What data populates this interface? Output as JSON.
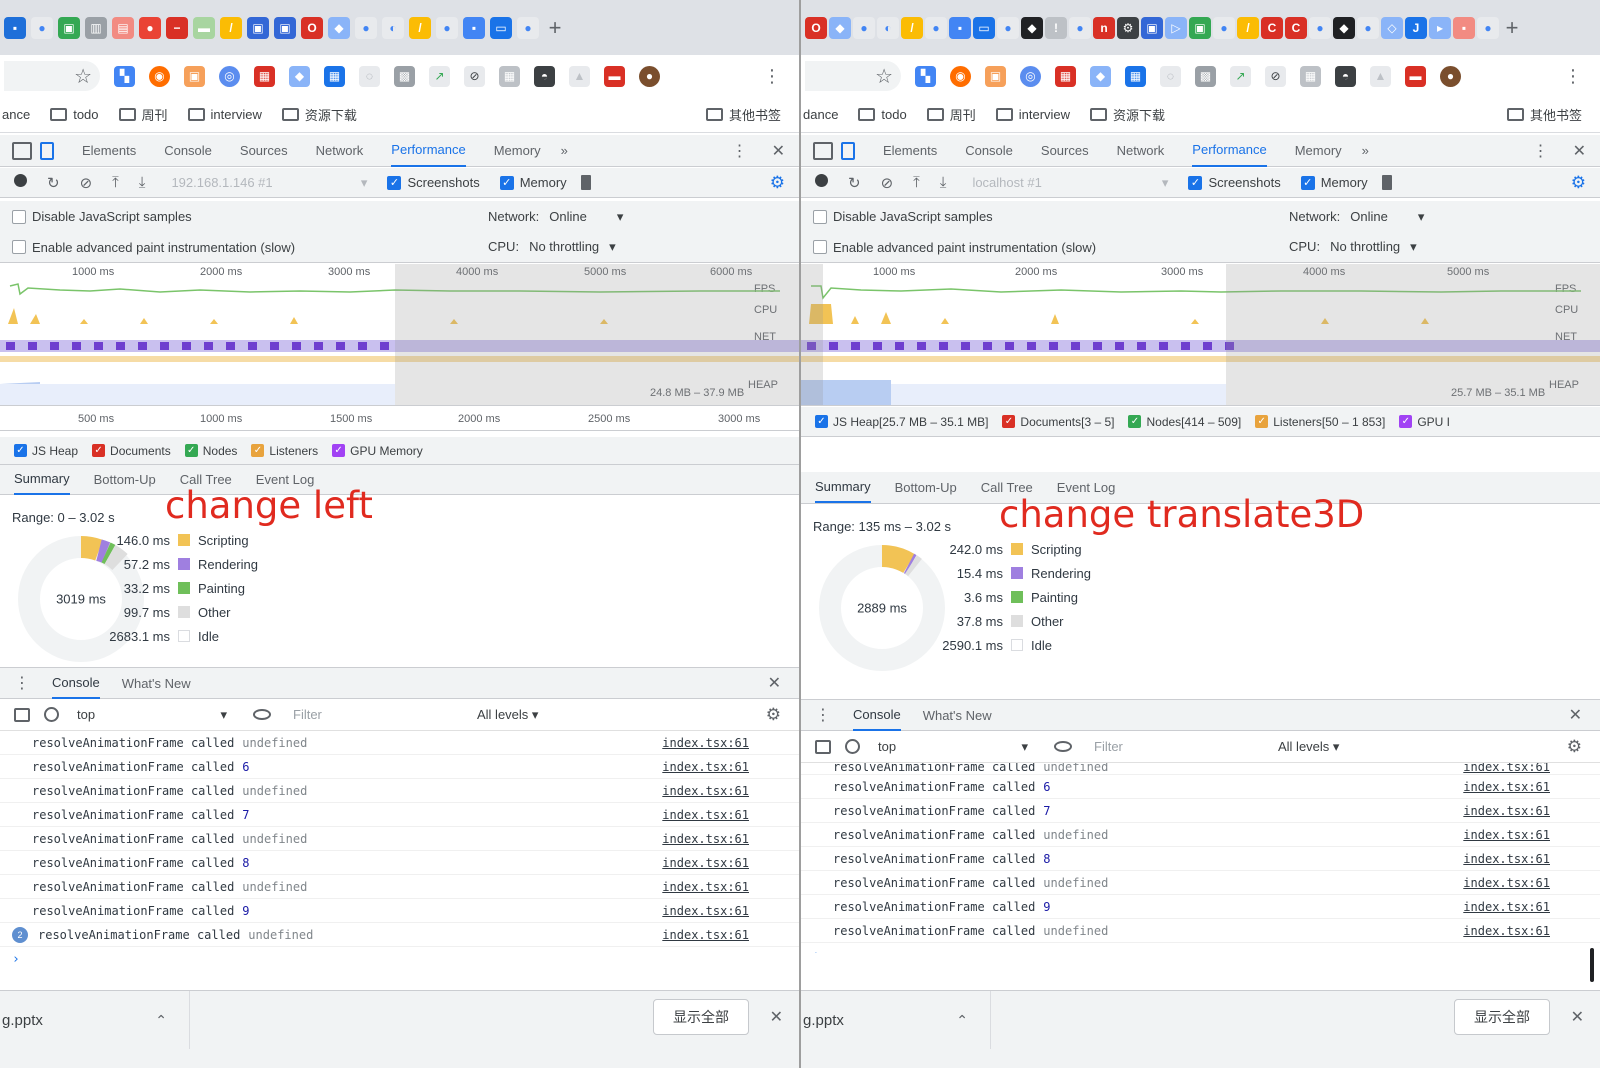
{
  "panes": [
    {
      "bookmarks": {
        "first": "ance",
        "items": [
          "todo",
          "周刊",
          "interview",
          "资源下载"
        ],
        "other": "其他书签"
      },
      "devtools_tabs": [
        "Elements",
        "Console",
        "Sources",
        "Network",
        "Performance",
        "Memory"
      ],
      "devtools_tabs_more": "»",
      "target": "192.168.1.146 #1",
      "screenshots_label": "Screenshots",
      "memory_label": "Memory",
      "disable_js_samples": "Disable JavaScript samples",
      "advanced_paint": "Enable advanced paint instrumentation (slow)",
      "network_label": "Network:",
      "network_value": "Online",
      "cpu_label": "CPU:",
      "cpu_value": "No throttling",
      "overview_ticks": [
        "1000 ms",
        "2000 ms",
        "3000 ms",
        "4000 ms",
        "5000 ms",
        "6000 ms"
      ],
      "overview_labels": {
        "fps": "FPS",
        "cpu": "CPU",
        "net": "NET",
        "heap": "HEAP",
        "heap_range": "24.8 MB – 37.9 MB"
      },
      "time_ruler": [
        "500 ms",
        "1000 ms",
        "1500 ms",
        "2000 ms",
        "2500 ms",
        "3000 ms"
      ],
      "memory_legend": [
        "JS Heap",
        "Documents",
        "Nodes",
        "Listeners",
        "GPU Memory"
      ],
      "detail_tabs": [
        "Summary",
        "Bottom-Up",
        "Call Tree",
        "Event Log"
      ],
      "range": "Range: 0 – 3.02 s",
      "annotation": "change left",
      "total": "3019 ms",
      "stats": [
        {
          "value": "146.0 ms",
          "label": "Scripting",
          "color": "#f2c355"
        },
        {
          "value": "57.2 ms",
          "label": "Rendering",
          "color": "#9f7fe0"
        },
        {
          "value": "33.2 ms",
          "label": "Painting",
          "color": "#6fbf5a"
        },
        {
          "value": "99.7 ms",
          "label": "Other",
          "color": "#dedede"
        },
        {
          "value": "2683.1 ms",
          "label": "Idle",
          "color": "#ffffff"
        }
      ],
      "drawer_tabs": [
        "Console",
        "What's New"
      ],
      "context": "top",
      "filter_placeholder": "Filter",
      "levels": "All levels ▾",
      "log_message": "resolveAnimationFrame called",
      "log_args": [
        "undefined",
        "6",
        "undefined",
        "7",
        "undefined",
        "8",
        "undefined",
        "9",
        "undefined"
      ],
      "log_source": "index.tsx:61",
      "repeat_count": "2",
      "download_name": "g.pptx",
      "show_all": "显示全部"
    },
    {
      "bookmarks": {
        "first": "dance",
        "items": [
          "todo",
          "周刊",
          "interview",
          "资源下载"
        ],
        "other": "其他书签"
      },
      "devtools_tabs": [
        "Elements",
        "Console",
        "Sources",
        "Network",
        "Performance",
        "Memory"
      ],
      "devtools_tabs_more": "»",
      "target": "localhost #1",
      "screenshots_label": "Screenshots",
      "memory_label": "Memory",
      "disable_js_samples": "Disable JavaScript samples",
      "advanced_paint": "Enable advanced paint instrumentation (slow)",
      "network_label": "Network:",
      "network_value": "Online",
      "cpu_label": "CPU:",
      "cpu_value": "No throttling",
      "overview_ticks": [
        "1000 ms",
        "2000 ms",
        "3000 ms",
        "4000 ms",
        "5000 ms"
      ],
      "overview_labels": {
        "fps": "FPS",
        "cpu": "CPU",
        "net": "NET",
        "heap": "HEAP",
        "heap_range": "25.7 MB – 35.1 MB"
      },
      "memory_legend": [
        "JS Heap[25.7 MB – 35.1 MB]",
        "Documents[3 – 5]",
        "Nodes[414 – 509]",
        "Listeners[50 – 1 853]",
        "GPU I"
      ],
      "detail_tabs": [
        "Summary",
        "Bottom-Up",
        "Call Tree",
        "Event Log"
      ],
      "range": "Range: 135 ms – 3.02 s",
      "annotation": "change translate3D",
      "total": "2889 ms",
      "stats": [
        {
          "value": "242.0 ms",
          "label": "Scripting",
          "color": "#f2c355"
        },
        {
          "value": "15.4 ms",
          "label": "Rendering",
          "color": "#9f7fe0"
        },
        {
          "value": "3.6 ms",
          "label": "Painting",
          "color": "#6fbf5a"
        },
        {
          "value": "37.8 ms",
          "label": "Other",
          "color": "#dedede"
        },
        {
          "value": "2590.1 ms",
          "label": "Idle",
          "color": "#ffffff"
        }
      ],
      "drawer_tabs": [
        "Console",
        "What's New"
      ],
      "context": "top",
      "filter_placeholder": "Filter",
      "levels": "All levels ▾",
      "log_message": "resolveAnimationFrame called",
      "log_args": [
        "undefined",
        "6",
        "7",
        "undefined",
        "8",
        "undefined",
        "9",
        "undefined"
      ],
      "log_source": "index.tsx:61",
      "download_name": "g.pptx",
      "show_all": "显示全部"
    }
  ],
  "colors": {
    "accent": "#1a73e8",
    "annotation": "#e02a1f",
    "scripting": "#f2c355",
    "rendering": "#9f7fe0",
    "painting": "#6fbf5a",
    "fps_green": "#7ac46a",
    "heap_blue": "#b8cdf2"
  },
  "icons": [
    "record-icon",
    "reload-icon",
    "clear-icon",
    "upload-icon",
    "download-icon",
    "trash-icon",
    "gear-icon",
    "eye-icon",
    "block-icon",
    "close-icon",
    "folder-icon",
    "star-icon"
  ]
}
